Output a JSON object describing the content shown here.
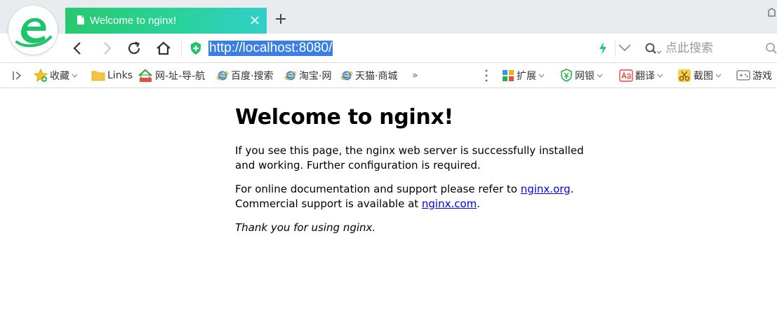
{
  "browser": {
    "tab": {
      "title": "Welcome to nginx!"
    },
    "address_bar": {
      "url": "http://localhost:8080/"
    },
    "search": {
      "placeholder": "点此搜索"
    },
    "icons": {
      "logo": "browser-logo-e",
      "tab_page": "page-icon",
      "tab_close": "close-icon",
      "new_tab": "plus-icon",
      "back": "chevron-left-icon",
      "forward": "chevron-right-icon",
      "reload": "reload-icon",
      "home": "home-icon",
      "security": "shield-icon",
      "speed": "lightning-icon",
      "dropdown": "chevron-down-icon",
      "search": "search-icon"
    },
    "colors": {
      "tab_gradient_start": "#27c96e",
      "tab_gradient_end": "#30d0c8",
      "logo_green": "#1ec46b",
      "url_highlight": "#3b7fe0",
      "link": "#0000ee"
    }
  },
  "bookmarks": {
    "items": [
      {
        "label": "收藏",
        "icon": "star-icon"
      },
      {
        "label": "Links",
        "icon": "folder-icon"
      },
      {
        "label": "网-址-导-航",
        "icon": "house-icon"
      },
      {
        "label": "百度·搜索",
        "icon": "ie-icon"
      },
      {
        "label": "淘宝·网",
        "icon": "ie-icon"
      },
      {
        "label": "天猫·商城",
        "icon": "ie-icon"
      }
    ],
    "more": "»",
    "tools": [
      {
        "label": "扩展",
        "icon": "extensions-icon"
      },
      {
        "label": "网银",
        "icon": "bank-shield-icon"
      },
      {
        "label": "翻译",
        "icon": "translate-icon"
      },
      {
        "label": "截图",
        "icon": "scissors-icon"
      },
      {
        "label": "游戏",
        "icon": "gamepad-icon"
      }
    ]
  },
  "page": {
    "heading": "Welcome to nginx!",
    "p1": "If you see this page, the nginx web server is successfully installed and working. Further configuration is required.",
    "p2_before": "For online documentation and support please refer to ",
    "p2_link1": "nginx.org",
    "p2_mid": ".",
    "p2_line2": "Commercial support is available at ",
    "p2_link2": "nginx.com",
    "p2_end": ".",
    "p3": "Thank you for using nginx."
  }
}
